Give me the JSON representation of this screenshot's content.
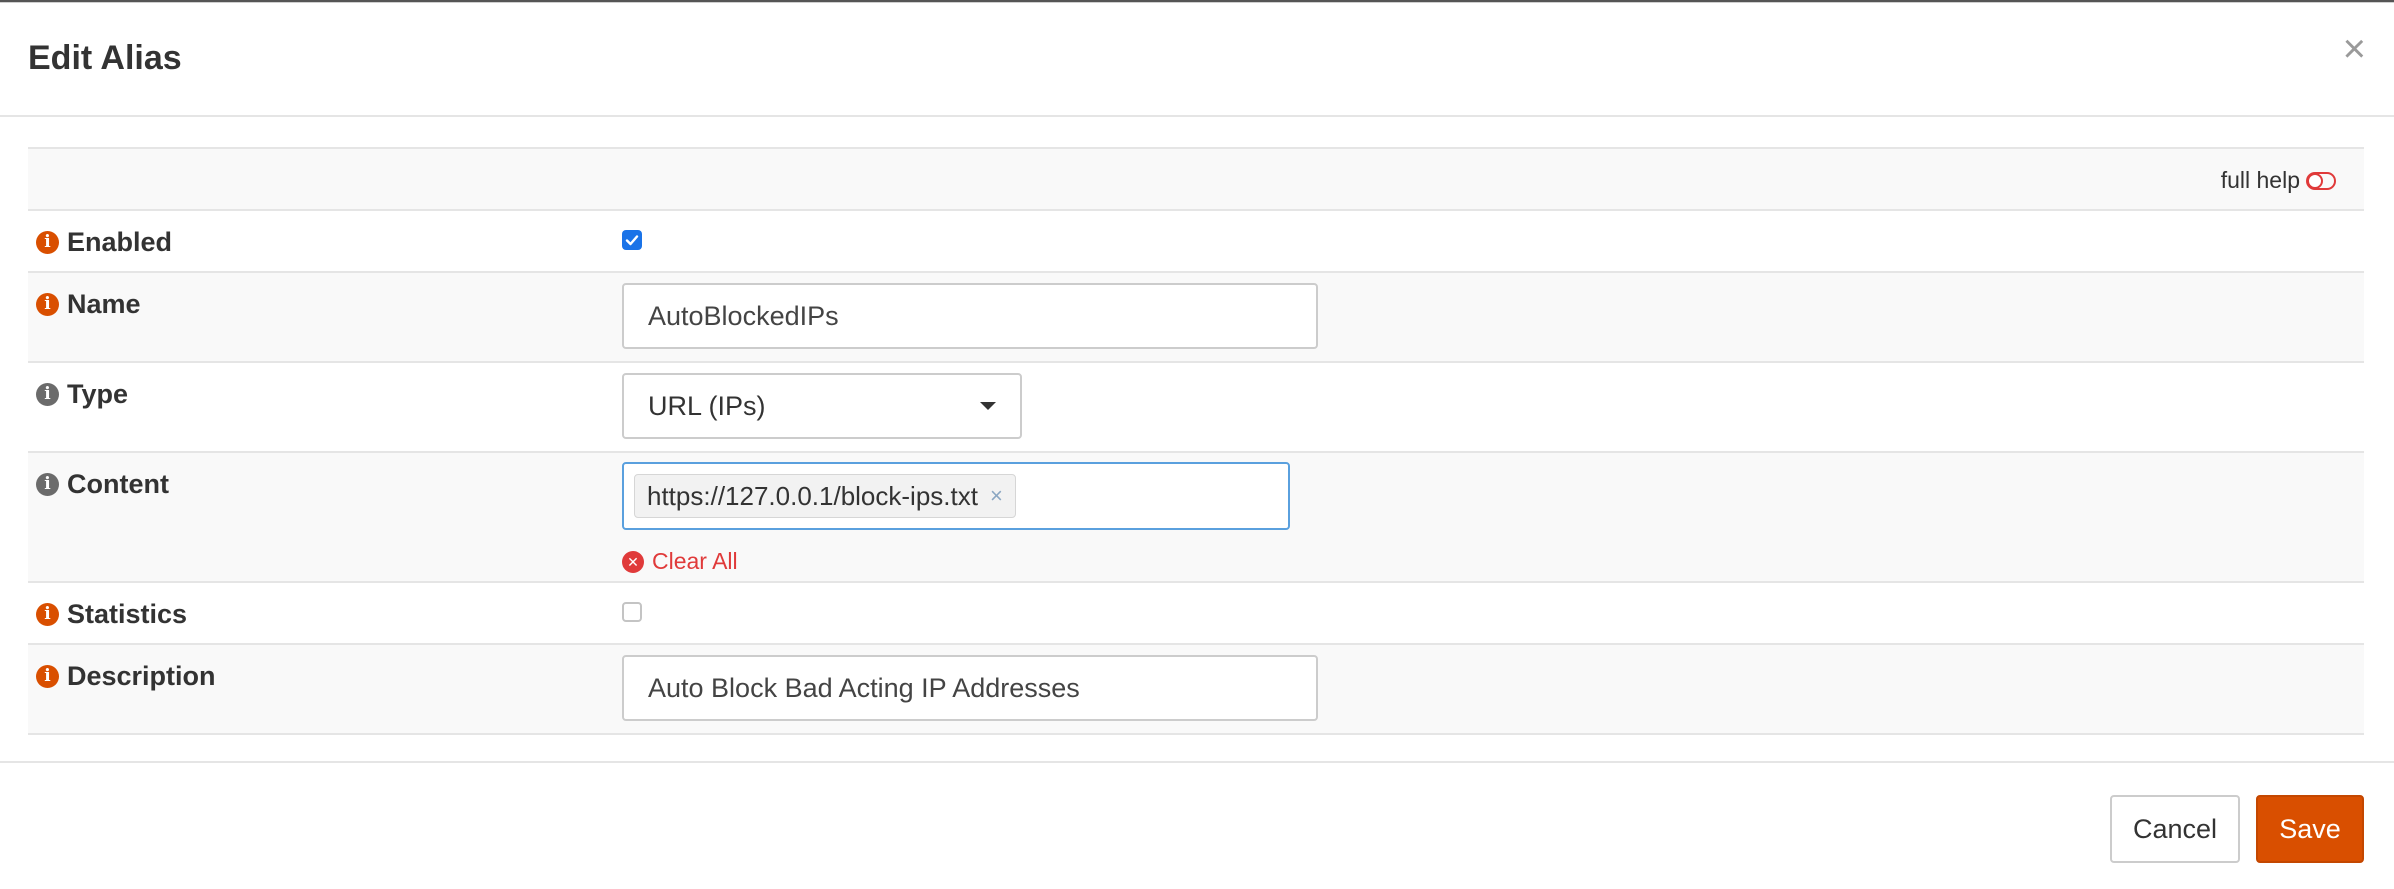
{
  "dialog": {
    "title": "Edit Alias",
    "close_symbol": "×"
  },
  "help": {
    "label": "full help",
    "state": "off"
  },
  "fields": {
    "enabled": {
      "label": "Enabled",
      "checked": true
    },
    "name": {
      "label": "Name",
      "value": "AutoBlockedIPs"
    },
    "type": {
      "label": "Type",
      "selected": "URL (IPs)"
    },
    "content": {
      "label": "Content",
      "tags": [
        "https://127.0.0.1/block-ips.txt"
      ],
      "tag_remove_symbol": "×",
      "clear_all": "Clear All"
    },
    "statistics": {
      "label": "Statistics",
      "checked": false
    },
    "description": {
      "label": "Description",
      "value": "Auto Block Bad Acting IP Addresses"
    }
  },
  "footer": {
    "cancel": "Cancel",
    "save": "Save"
  },
  "icons": {
    "info": "info-icon",
    "close": "close-icon",
    "toggle": "toggle-off-icon",
    "caret": "caret-down-icon",
    "clear": "times-circle-icon"
  },
  "colors": {
    "accent": "#d94f00",
    "info_inactive": "#6b6b6b",
    "checkbox_active": "#1a73e8",
    "danger": "#e03a3a",
    "focus_border": "#5aa0de"
  }
}
